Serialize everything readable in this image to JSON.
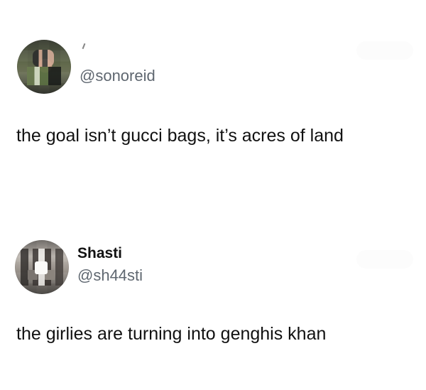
{
  "posts": [
    {
      "handle": "@sonoreid",
      "text": "the goal isn’t gucci bags, it’s acres of land"
    },
    {
      "display_name": "Shasti",
      "handle": "@sh44sti",
      "text": "the girlies are turning into genghis khan"
    }
  ]
}
